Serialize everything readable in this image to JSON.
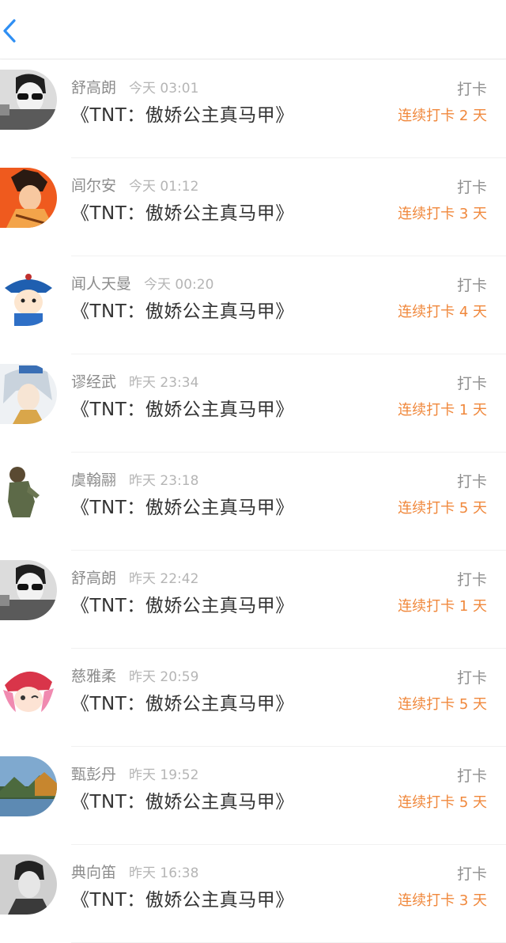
{
  "header": {
    "back_icon": "chevron-left-icon",
    "accent": "#2f8ff3"
  },
  "colors": {
    "streak": "#f0883c",
    "name": "#8c8c8c",
    "time": "#b5b5b5"
  },
  "rows": [
    {
      "name": "舒高朗",
      "time": "今天 03:01",
      "book": "《TNT：傲娇公主真马甲》",
      "action": "打卡",
      "streak": "连续打卡 2 天",
      "avatar": "avatar-sunglasses-bw"
    },
    {
      "name": "闾尔安",
      "time": "今天 01:12",
      "book": "《TNT：傲娇公主真马甲》",
      "action": "打卡",
      "streak": "连续打卡 3 天",
      "avatar": "avatar-anime-orange"
    },
    {
      "name": "闻人天曼",
      "time": "今天 00:20",
      "book": "《TNT：傲娇公主真马甲》",
      "action": "打卡",
      "streak": "连续打卡 4 天",
      "avatar": "avatar-cartoon-blue-hat"
    },
    {
      "name": "谬经武",
      "time": "昨天 23:34",
      "book": "《TNT：傲娇公主真马甲》",
      "action": "打卡",
      "streak": "连续打卡 1 天",
      "avatar": "avatar-anime-white-hair"
    },
    {
      "name": "虞翰翮",
      "time": "昨天 23:18",
      "book": "《TNT：傲娇公主真马甲》",
      "action": "打卡",
      "streak": "连续打卡 5 天",
      "avatar": "avatar-bronze-statue"
    },
    {
      "name": "舒高朗",
      "time": "昨天 22:42",
      "book": "《TNT：傲娇公主真马甲》",
      "action": "打卡",
      "streak": "连续打卡 1 天",
      "avatar": "avatar-sunglasses-bw"
    },
    {
      "name": "慈雅柔",
      "time": "昨天 20:59",
      "book": "《TNT：傲娇公主真马甲》",
      "action": "打卡",
      "streak": "连续打卡 5 天",
      "avatar": "avatar-cartoon-pink-hair"
    },
    {
      "name": "甄彭丹",
      "time": "昨天 19:52",
      "book": "《TNT：傲娇公主真马甲》",
      "action": "打卡",
      "streak": "连续打卡 5 天",
      "avatar": "avatar-landscape-lake"
    },
    {
      "name": "典向笛",
      "time": "昨天 16:38",
      "book": "《TNT：傲娇公主真马甲》",
      "action": "打卡",
      "streak": "连续打卡 3 天",
      "avatar": "avatar-person-bw"
    }
  ]
}
